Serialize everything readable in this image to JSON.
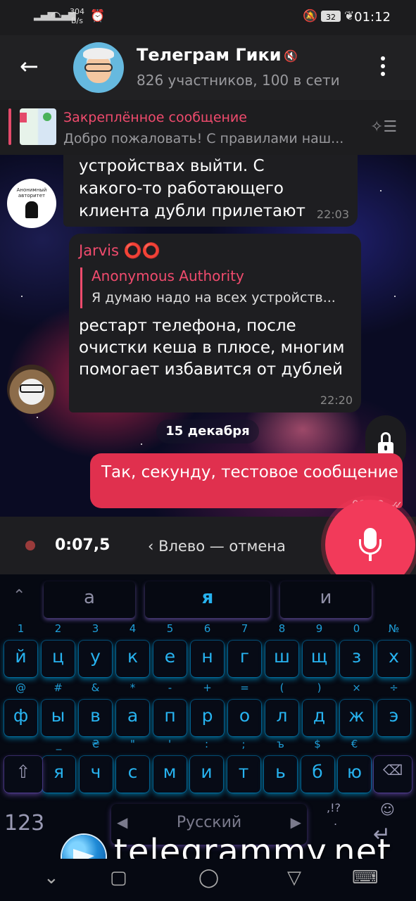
{
  "status_bar": {
    "speed": "304\nB/s",
    "battery": "32",
    "time": "01:12"
  },
  "header": {
    "title": "Телеграм Гики",
    "subtitle": "826 участников, 100 в сети"
  },
  "pinned": {
    "title": "Закреплённое сообщение",
    "text": "Добро пожаловать! С правилами наш..."
  },
  "messages": {
    "m1": {
      "text": "устройствах выйти. С какого-то работающего клиента дубли прилетают",
      "time": "22:03",
      "avatar_text": "Анонимный авторитет"
    },
    "m2": {
      "sender": "Jarvis ⭕⭕",
      "reply_name": "Anonymous Authority",
      "reply_text": "Я думаю надо на всех устройств...",
      "text": "рестарт телефона, после очистки кеша в плюсе, многим помогает избавится от дублей",
      "time": "22:20"
    },
    "date": "15 декабря",
    "m3": {
      "text": "Так, секунду, тестовое сообщение",
      "time": "01:12"
    }
  },
  "recording": {
    "time": "0:07,5",
    "cancel": "Влево — отмена"
  },
  "keyboard": {
    "suggestions": [
      "а",
      "я",
      "и"
    ],
    "row1": {
      "keys": [
        "й",
        "ц",
        "у",
        "к",
        "е",
        "н",
        "г",
        "ш",
        "щ",
        "з",
        "х"
      ],
      "hints": [
        "1",
        "2",
        "3",
        "4",
        "5",
        "6",
        "7",
        "8",
        "9",
        "0",
        "№"
      ]
    },
    "row2": {
      "keys": [
        "ф",
        "ы",
        "в",
        "а",
        "п",
        "р",
        "о",
        "л",
        "д",
        "ж",
        "э"
      ],
      "hints": [
        "@",
        "#",
        "&",
        "*",
        "-",
        "+",
        "=",
        "(",
        ")",
        "×",
        "÷"
      ]
    },
    "row3": {
      "keys": [
        "я",
        "ч",
        "с",
        "м",
        "и",
        "т",
        "ь",
        "б",
        "ю"
      ],
      "hints": [
        "_",
        "₴",
        "\"",
        "'",
        ":",
        ";",
        "ъ",
        "$",
        "€"
      ]
    },
    "key_123": "123",
    "space_label": "Русский",
    "punct": ",!?",
    "punct_dot": "."
  },
  "watermark": "telegrammy.net"
}
